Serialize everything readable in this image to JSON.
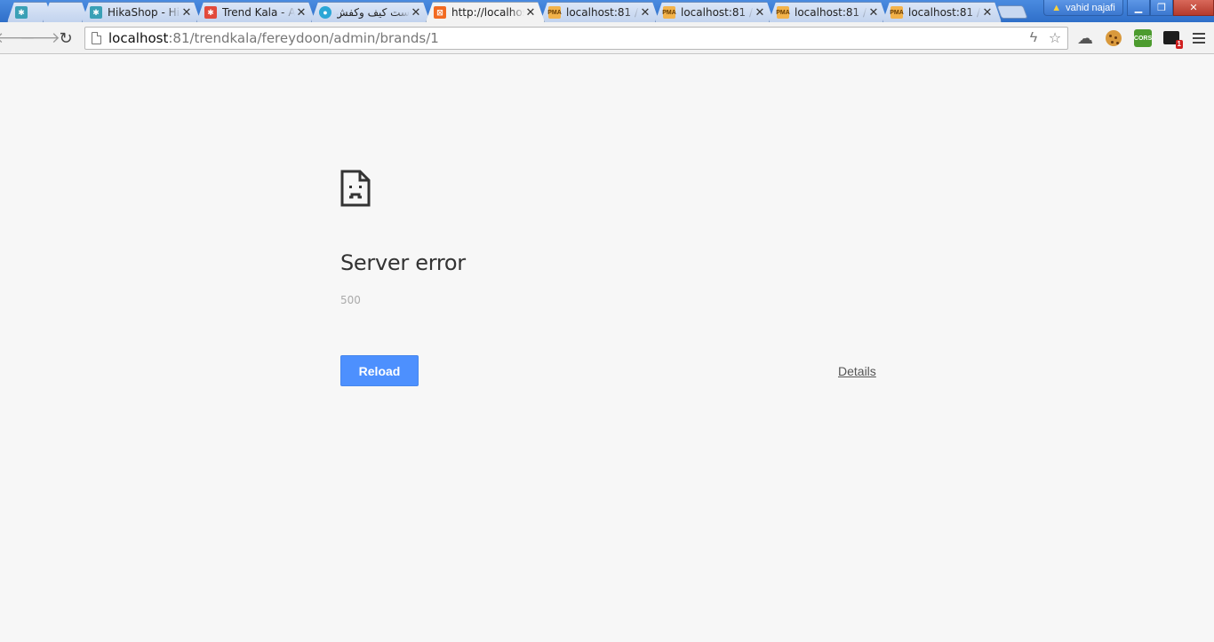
{
  "browser": {
    "tabs": [
      {
        "title": "",
        "favicon": "joomla-icon",
        "active": false
      },
      {
        "title": "",
        "favicon": "",
        "active": false
      },
      {
        "title": "HikaShop - Hi",
        "favicon": "joomla-icon",
        "active": false
      },
      {
        "title": "Trend Kala - A",
        "favicon": "joomla-icon",
        "active": false
      },
      {
        "title": "ست کیف وکفش",
        "favicon": "circle-icon",
        "active": false
      },
      {
        "title": "http://localhos",
        "favicon": "xampp-icon",
        "active": true
      },
      {
        "title": "localhost:81 /",
        "favicon": "phpmyadmin-icon",
        "active": false
      },
      {
        "title": "localhost:81 /",
        "favicon": "phpmyadmin-icon",
        "active": false
      },
      {
        "title": "localhost:81 /",
        "favicon": "phpmyadmin-icon",
        "active": false
      },
      {
        "title": "localhost:81 /",
        "favicon": "phpmyadmin-icon",
        "active": false
      }
    ],
    "profile_name": "vahid najafi",
    "url_host": "localhost",
    "url_rest": ":81/trendkala/fereydoon/admin/brands/1",
    "extensions": {
      "cors_label": "CORS",
      "badge_count": "1"
    },
    "pma_label": "PMA"
  },
  "error_page": {
    "title": "Server error",
    "code": "500",
    "reload_label": "Reload",
    "details_label": "Details"
  },
  "colors": {
    "accent": "#4d90fe",
    "page_bg": "#f7f7f7"
  }
}
